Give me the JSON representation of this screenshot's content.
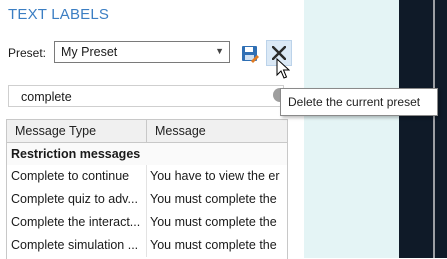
{
  "panel": {
    "title": "TEXT LABELS"
  },
  "preset": {
    "label": "Preset:",
    "selected": "My Preset"
  },
  "tooltip": {
    "text": "Delete the current preset"
  },
  "search": {
    "value": "complete"
  },
  "table": {
    "headers": [
      "Message Type",
      "Message"
    ],
    "group": "Restriction messages",
    "rows": [
      {
        "type": "Complete to continue",
        "message": "You have to view the er"
      },
      {
        "type": "Complete quiz to adv...",
        "message": "You must complete the"
      },
      {
        "type": "Complete the interact...",
        "message": "You must complete the"
      },
      {
        "type": "Complete simulation ...",
        "message": "You must complete the"
      }
    ]
  },
  "colors": {
    "accent": "#3b7ec3",
    "canvas": "#e4f4f5",
    "slide": "#0f1a28"
  },
  "icons": [
    "save-icon",
    "close-icon",
    "cursor-icon",
    "search-icon",
    "chevron-down-icon"
  ]
}
